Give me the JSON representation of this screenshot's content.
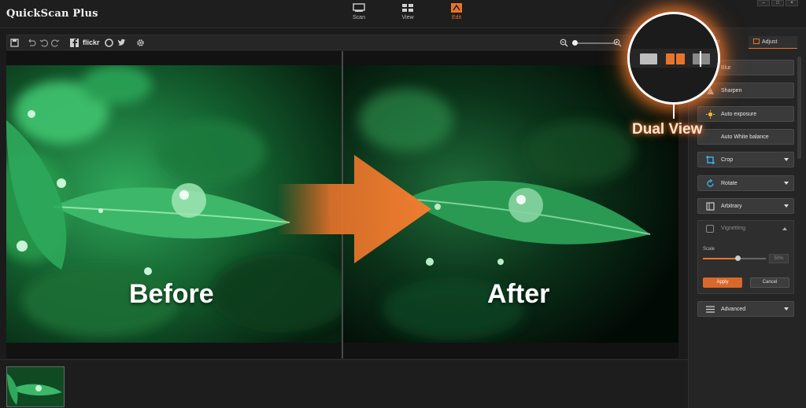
{
  "app": {
    "title": "QuickScan Plus"
  },
  "modes": [
    {
      "label": "Scan",
      "icon": "scanner-icon"
    },
    {
      "label": "View",
      "icon": "grid-view-icon"
    },
    {
      "label": "Edit",
      "icon": "edit-icon"
    }
  ],
  "active_mode": "Edit",
  "toolbar": {
    "flickr_label": "flickr",
    "icons": [
      "save-icon",
      "undo-all-icon",
      "undo-icon",
      "redo-icon",
      "facebook-icon",
      "flickr-icon",
      "twitter-icon",
      "settings-icon",
      "zoom-out-icon",
      "zoom-in-icon"
    ],
    "zoom_level": 0.05
  },
  "canvas": {
    "before_caption": "Before",
    "after_caption": "After"
  },
  "panel": {
    "tabs": [
      "ect",
      "Adjust"
    ],
    "active_tab": "Adjust",
    "tools": [
      {
        "label": "Blur"
      },
      {
        "label": "Sharpen"
      },
      {
        "label": "Auto exposure"
      },
      {
        "label": "Auto White balance"
      },
      {
        "label": "Crop"
      },
      {
        "label": "Rotate"
      },
      {
        "label": "Arbitrary"
      }
    ],
    "vignetting": {
      "title": "Vignetting",
      "scale_label": "Scale",
      "scale_value": "50%",
      "scale_level": 0.55,
      "apply_label": "Apply",
      "cancel_label": "Cancel"
    },
    "advanced_label": "Advanced"
  },
  "callout": {
    "label": "Dual View"
  },
  "colors": {
    "accent": "#e8742b",
    "background": "#1b1b1b",
    "panel": "#252525"
  }
}
